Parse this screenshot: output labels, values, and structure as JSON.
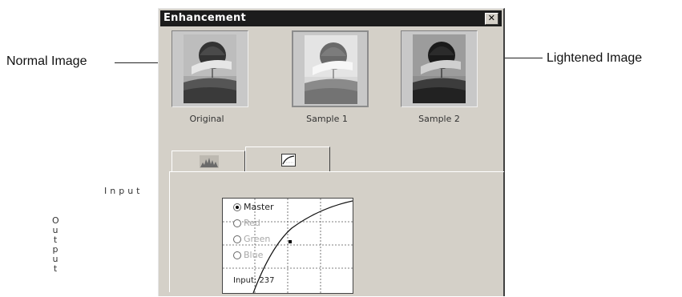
{
  "callouts": {
    "left": "Normal Image",
    "right": "Lightened Image"
  },
  "dialog": {
    "title": "Enhancement",
    "close_glyph": "✕"
  },
  "samples": [
    {
      "caption": "Original"
    },
    {
      "caption": "Sample 1"
    },
    {
      "caption": "Sample 2"
    }
  ],
  "tabs": {
    "histogram_icon": "histogram-icon",
    "curve_icon": "curve-icon"
  },
  "curve_panel": {
    "input_axis_label": "Input",
    "output_axis_label": "Output",
    "channels": [
      {
        "label": "Master",
        "selected": true,
        "enabled": true
      },
      {
        "label": "Red",
        "selected": false,
        "enabled": false
      },
      {
        "label": "Green",
        "selected": false,
        "enabled": false
      },
      {
        "label": "Blue",
        "selected": false,
        "enabled": false
      }
    ],
    "input_readout": "Input:  237"
  }
}
